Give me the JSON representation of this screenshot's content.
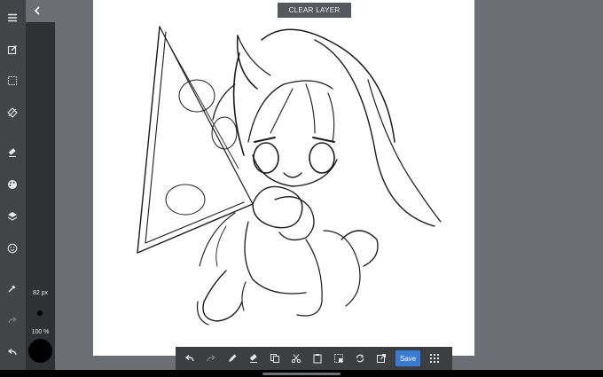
{
  "colors": {
    "rail": "#424447",
    "subpanel": "#2f3133",
    "workspace": "#6b6e72",
    "toolbar": "#3c3e41",
    "save_accent": "#3a7bd5",
    "canvas": "#ffffff",
    "current_color": "#000000"
  },
  "header": {
    "clear_layer_label": "CLEAR LAYER"
  },
  "sidebar": {
    "icons": [
      "menu-icon",
      "edit-square-icon",
      "selection-icon",
      "rotate-icon",
      "eraser-icon",
      "palette-icon",
      "layers-icon",
      "face-icon",
      "eyedropper-icon",
      "redo-icon",
      "undo-icon"
    ],
    "brush_size": "82 px",
    "brush_opacity": "100 %"
  },
  "toolbar": {
    "icons": [
      "undo-icon",
      "redo-icon",
      "pencil-icon",
      "eraser-icon",
      "copy-icon",
      "cut-icon",
      "paste-icon",
      "select-icon",
      "rotate-icon",
      "export-icon",
      "grid-icon"
    ],
    "save_label": "Save"
  }
}
